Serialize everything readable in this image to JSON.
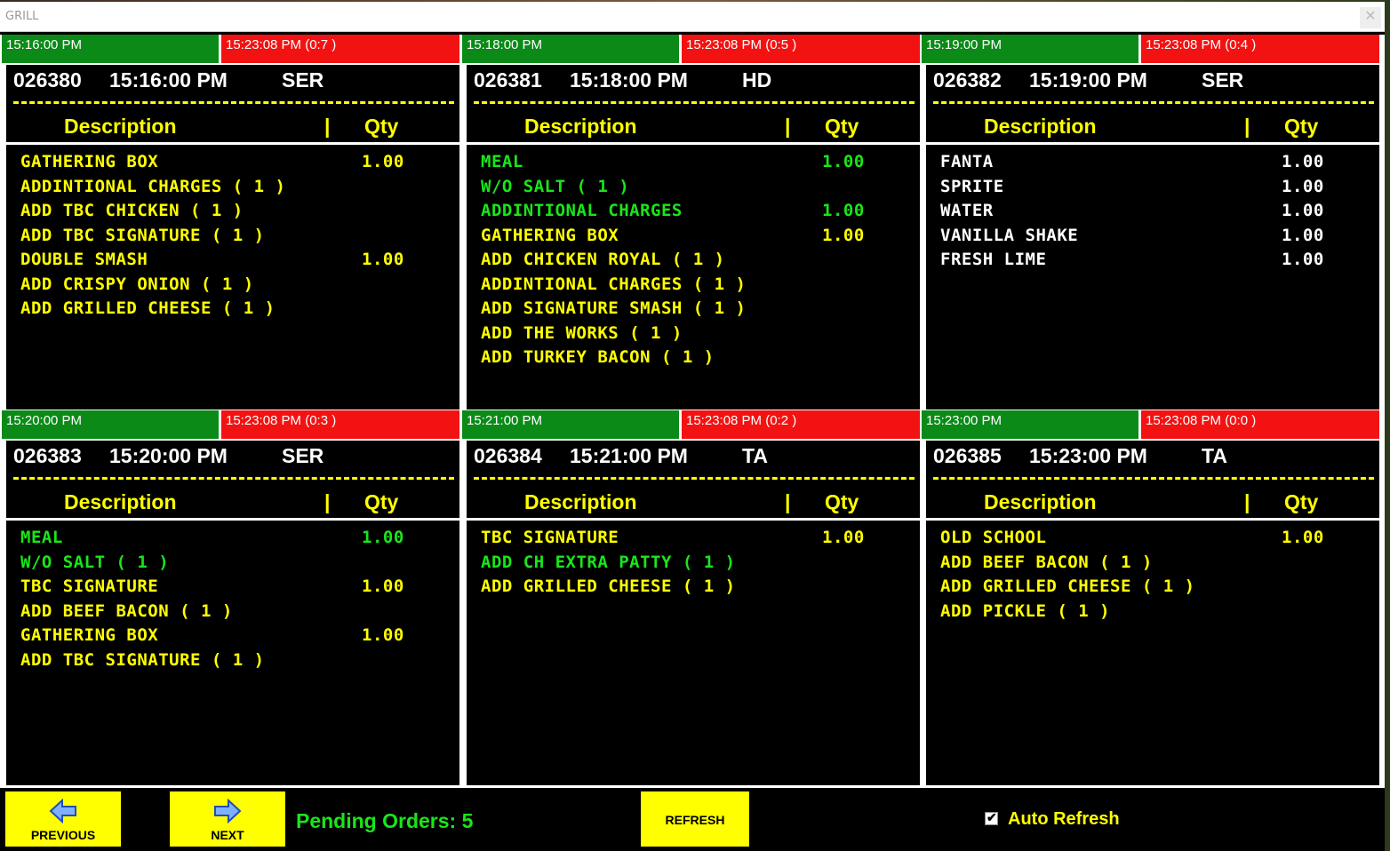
{
  "window": {
    "title": "GRILL",
    "close_glyph": "✕"
  },
  "orders": [
    {
      "start_time": "15:16:00 PM",
      "current_time": "15:23:08 PM  (0:7 )",
      "order_no": "026380",
      "order_time": "15:16:00 PM",
      "order_type": "SER",
      "col_desc": "Description",
      "col_sep": "|",
      "col_qty": "Qty",
      "items": [
        {
          "name": "GATHERING BOX",
          "qty": "1.00",
          "color": "yellow"
        },
        {
          "name": "ADDINTIONAL CHARGES ( 1 )",
          "qty": "",
          "color": "yellow"
        },
        {
          "name": "ADD TBC CHICKEN ( 1 )",
          "qty": "",
          "color": "yellow"
        },
        {
          "name": "ADD TBC SIGNATURE ( 1 )",
          "qty": "",
          "color": "yellow"
        },
        {
          "name": "DOUBLE SMASH",
          "qty": "1.00",
          "color": "yellow"
        },
        {
          "name": "ADD CRISPY ONION ( 1 )",
          "qty": "",
          "color": "yellow"
        },
        {
          "name": "ADD GRILLED CHEESE ( 1 )",
          "qty": "",
          "color": "yellow"
        }
      ]
    },
    {
      "start_time": "15:18:00 PM",
      "current_time": "15:23:08 PM  (0:5 )",
      "order_no": "026381",
      "order_time": "15:18:00 PM",
      "order_type": "HD",
      "col_desc": "Description",
      "col_sep": "|",
      "col_qty": "Qty",
      "items": [
        {
          "name": "MEAL",
          "qty": "1.00",
          "color": "green"
        },
        {
          "name": "W/O SALT ( 1 )",
          "qty": "",
          "color": "green"
        },
        {
          "name": "ADDINTIONAL CHARGES",
          "qty": "1.00",
          "color": "green"
        },
        {
          "name": "GATHERING BOX",
          "qty": "1.00",
          "color": "yellow"
        },
        {
          "name": "ADD CHICKEN ROYAL ( 1 )",
          "qty": "",
          "color": "yellow"
        },
        {
          "name": "ADDINTIONAL CHARGES ( 1 )",
          "qty": "",
          "color": "yellow"
        },
        {
          "name": "ADD SIGNATURE SMASH ( 1 )",
          "qty": "",
          "color": "yellow"
        },
        {
          "name": "ADD THE WORKS ( 1 )",
          "qty": "",
          "color": "yellow"
        },
        {
          "name": "ADD TURKEY BACON ( 1 )",
          "qty": "",
          "color": "yellow"
        }
      ]
    },
    {
      "start_time": "15:19:00 PM",
      "current_time": "15:23:08 PM  (0:4 )",
      "order_no": "026382",
      "order_time": "15:19:00 PM",
      "order_type": "SER",
      "col_desc": "Description",
      "col_sep": "|",
      "col_qty": "Qty",
      "items": [
        {
          "name": "FANTA",
          "qty": "1.00",
          "color": "white"
        },
        {
          "name": "SPRITE",
          "qty": "1.00",
          "color": "white"
        },
        {
          "name": "WATER",
          "qty": "1.00",
          "color": "white"
        },
        {
          "name": "VANILLA SHAKE",
          "qty": "1.00",
          "color": "white"
        },
        {
          "name": "FRESH LIME",
          "qty": "1.00",
          "color": "white"
        }
      ]
    },
    {
      "start_time": "15:20:00 PM",
      "current_time": "15:23:08 PM  (0:3 )",
      "order_no": "026383",
      "order_time": "15:20:00 PM",
      "order_type": "SER",
      "col_desc": "Description",
      "col_sep": "|",
      "col_qty": "Qty",
      "items": [
        {
          "name": "MEAL",
          "qty": "1.00",
          "color": "green"
        },
        {
          "name": "W/O SALT ( 1 )",
          "qty": "",
          "color": "green"
        },
        {
          "name": "TBC SIGNATURE",
          "qty": "1.00",
          "color": "yellow"
        },
        {
          "name": "ADD BEEF BACON ( 1 )",
          "qty": "",
          "color": "yellow"
        },
        {
          "name": "GATHERING BOX",
          "qty": "1.00",
          "color": "yellow"
        },
        {
          "name": "ADD TBC SIGNATURE ( 1 )",
          "qty": "",
          "color": "yellow"
        }
      ]
    },
    {
      "start_time": "15:21:00 PM",
      "current_time": "15:23:08 PM  (0:2 )",
      "order_no": "026384",
      "order_time": "15:21:00 PM",
      "order_type": "TA",
      "col_desc": "Description",
      "col_sep": "|",
      "col_qty": "Qty",
      "items": [
        {
          "name": "TBC SIGNATURE",
          "qty": "1.00",
          "color": "yellow"
        },
        {
          "name": "ADD CH EXTRA PATTY ( 1 )",
          "qty": "",
          "color": "green"
        },
        {
          "name": "ADD GRILLED CHEESE ( 1 )",
          "qty": "",
          "color": "yellow"
        }
      ]
    },
    {
      "start_time": "15:23:00 PM",
      "current_time": "15:23:08 PM  (0:0 )",
      "order_no": "026385",
      "order_time": "15:23:00 PM",
      "order_type": "TA",
      "col_desc": "Description",
      "col_sep": "|",
      "col_qty": "Qty",
      "items": [
        {
          "name": "OLD SCHOOL",
          "qty": "1.00",
          "color": "yellow"
        },
        {
          "name": "ADD BEEF BACON ( 1 )",
          "qty": "",
          "color": "yellow"
        },
        {
          "name": "ADD GRILLED CHEESE ( 1 )",
          "qty": "",
          "color": "yellow"
        },
        {
          "name": "ADD PICKLE ( 1 )",
          "qty": "",
          "color": "yellow"
        }
      ]
    }
  ],
  "footer": {
    "previous_label": "PREVIOUS",
    "next_label": "NEXT",
    "pending_orders": "Pending Orders: 5",
    "refresh_label": "REFRESH",
    "auto_refresh_label": "Auto Refresh",
    "auto_refresh_checked": "✔"
  },
  "colors": {
    "start_bar": "#0b8a18",
    "now_bar": "#f21212",
    "yellow": "#ffff00",
    "green": "#19e619",
    "white": "#ffffff"
  }
}
